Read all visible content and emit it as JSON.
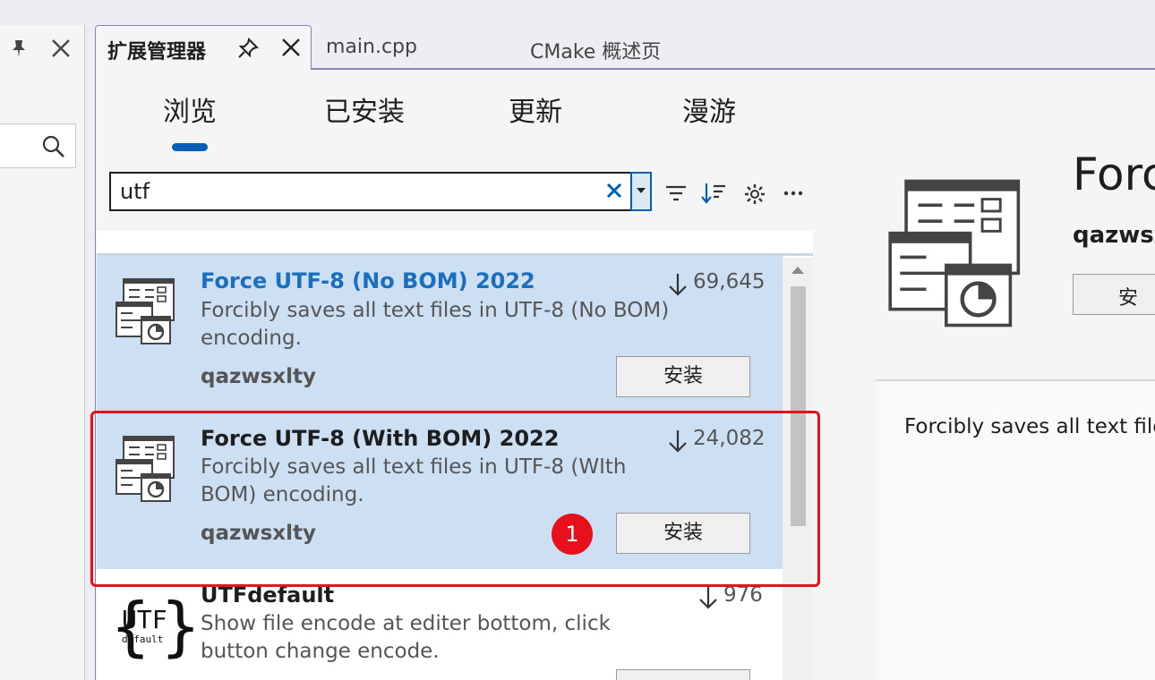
{
  "tabs": [
    {
      "label": "扩展管理器"
    },
    {
      "label": "main.cpp"
    },
    {
      "label": "CMake 概述页"
    }
  ],
  "nav": [
    "浏览",
    "已安装",
    "更新",
    "漫游"
  ],
  "search": {
    "value": "utf"
  },
  "extensions": [
    {
      "title": "Force UTF-8 (No BOM) 2022",
      "description": "Forcibly saves all text files in UTF-8 (No BOM) encoding.",
      "author": "qazwsxlty",
      "downloads": "69,645",
      "install_label": "安装",
      "title_color": "#1a6fc0"
    },
    {
      "title": "Force UTF-8 (With BOM) 2022",
      "description": "Forcibly saves all text files in UTF-8 (WIth BOM) encoding.",
      "author": "qazwsxlty",
      "downloads": "24,082",
      "install_label": "安装",
      "title_color": "#1e1e1e"
    },
    {
      "title": "UTFdefault",
      "description": "Show file encode at editer bottom, click button change encode.",
      "author": "",
      "downloads": "976",
      "icon_text_top": "UTF",
      "icon_text_bottom": "default"
    }
  ],
  "annotation": {
    "step": "1"
  },
  "detail": {
    "title": "Forc",
    "author": "qazwsx",
    "install_label": "安装",
    "description": "Forcibly saves all text file"
  },
  "colors": {
    "accent": "#005fb8",
    "selected_row": "#cddff3",
    "annotation_red": "#e8101c"
  }
}
